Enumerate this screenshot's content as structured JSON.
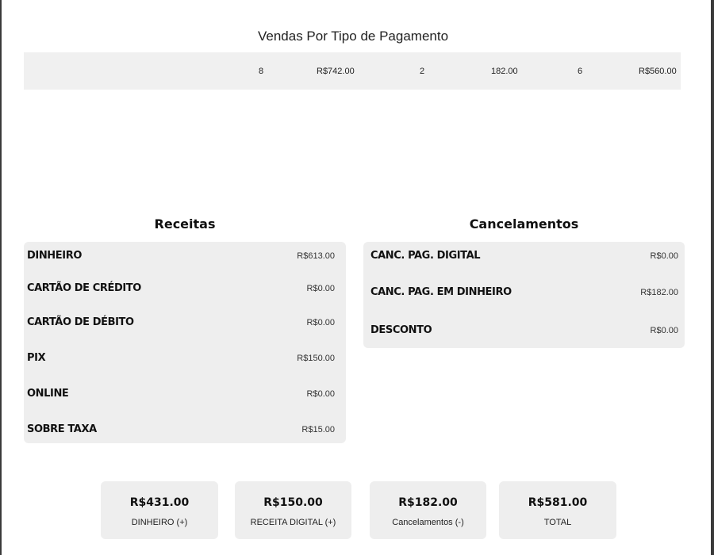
{
  "title": "Vendas Por Tipo de Pagamento",
  "payment_row": [
    "8",
    "R$742.00",
    "2",
    "182.00",
    "6",
    "R$560.00"
  ],
  "receitas": {
    "title": "Receitas",
    "items": [
      {
        "label": "DINHEIRO",
        "value": "R$613.00"
      },
      {
        "label": "CARTÃO DE CRÉDITO",
        "value": "R$0.00"
      },
      {
        "label": "CARTÃO DE DÉBITO",
        "value": "R$0.00"
      },
      {
        "label": "PIX",
        "value": "R$150.00"
      },
      {
        "label": "ONLINE",
        "value": "R$0.00"
      },
      {
        "label": "SOBRE TAXA",
        "value": "R$15.00"
      }
    ]
  },
  "cancelamentos": {
    "title": "Cancelamentos",
    "items": [
      {
        "label": "CANC. PAG. DIGITAL",
        "value": "R$0.00"
      },
      {
        "label": "CANC. PAG. EM DINHEIRO",
        "value": "R$182.00"
      },
      {
        "label": "DESCONTO",
        "value": "R$0.00"
      }
    ]
  },
  "summary": [
    {
      "value": "R$431.00",
      "label": "DINHEIRO (+)"
    },
    {
      "value": "R$150.00",
      "label": "RECEITA DIGITAL (+)"
    },
    {
      "value": "R$182.00",
      "label": "Cancelamentos (-)"
    },
    {
      "value": "R$581.00",
      "label": "TOTAL"
    }
  ]
}
